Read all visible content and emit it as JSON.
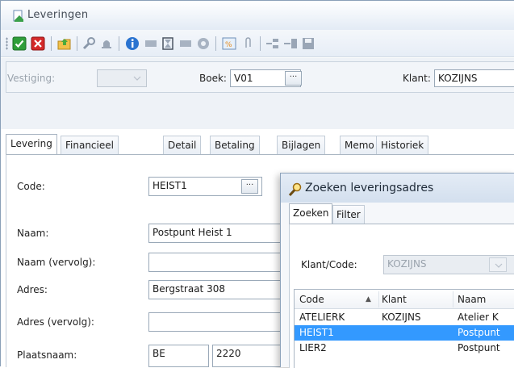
{
  "window": {
    "title": "Leveringen"
  },
  "filter": {
    "vestiging_label": "Vestiging:",
    "boek_label": "Boek:",
    "boek_value": "V01",
    "ellipsis": "···",
    "klant_label": "Klant:",
    "klant_value": "KOZIJNS"
  },
  "tabs": [
    "Levering",
    "Financieel",
    "Detail",
    "Betaling",
    "Bijlagen",
    "Memo",
    "Historiek"
  ],
  "form": {
    "code_label": "Code:",
    "code_value": "HEIST1",
    "naam_label": "Naam:",
    "naam_value": "Postpunt Heist 1",
    "naam_vervolg_label": "Naam (vervolg):",
    "naam_vervolg_value": "",
    "adres_label": "Adres:",
    "adres_value": "Bergstraat 308",
    "adres_vervolg_label": "Adres (vervolg):",
    "adres_vervolg_value": "",
    "plaatsnaam_label": "Plaatsnaam:",
    "land_value": "BE",
    "postcode_value": "2220"
  },
  "dialog": {
    "title": "Zoeken leveringsadres",
    "tabs": [
      "Zoeken",
      "Filter"
    ],
    "klant_code_label": "Klant/Code:",
    "klant_code_value": "KOZIJNS",
    "columns": [
      "Code",
      "Klant",
      "Naam"
    ],
    "sort_indicator": "▲",
    "rows": [
      {
        "code": "ATELIERK",
        "klant": "KOZIJNS",
        "naam": "Atelier K"
      },
      {
        "code": "HEIST1",
        "klant": "",
        "naam": "Postpunt"
      },
      {
        "code": "LIER2",
        "klant": "",
        "naam": "Postpunt"
      }
    ]
  },
  "colors": {
    "selection": "#3399ff",
    "accent": "#3b7dd8"
  }
}
